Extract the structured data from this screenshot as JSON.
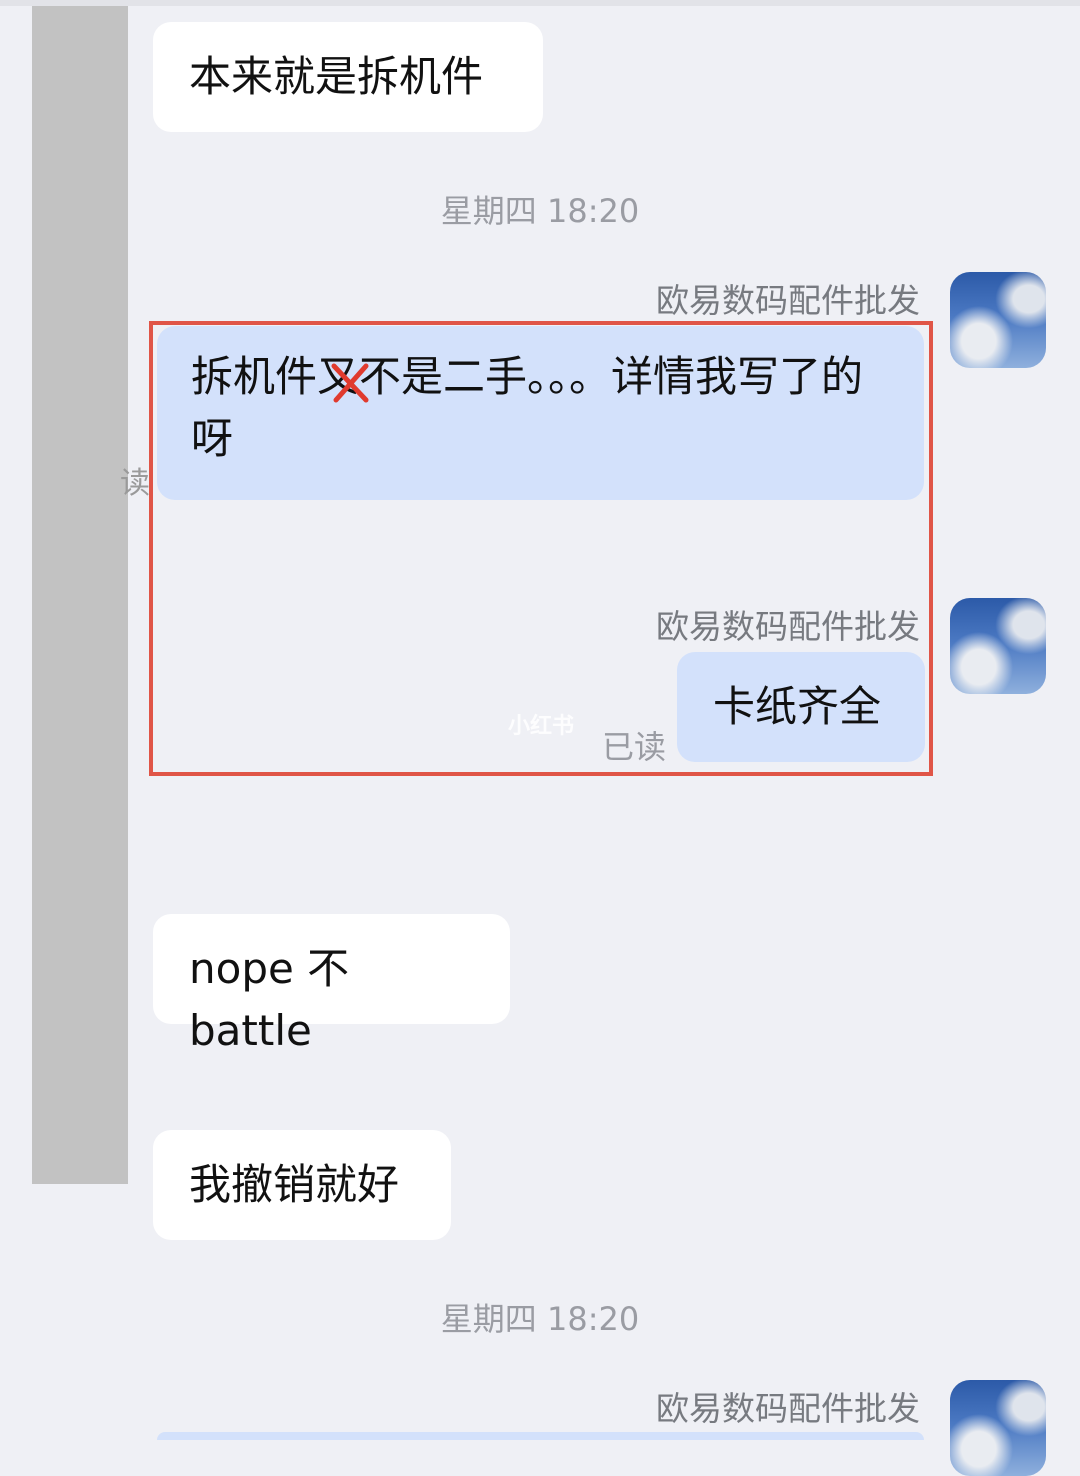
{
  "messages": {
    "m1": "本来就是拆机件",
    "m2": "拆机件又不是二手。。。详情我写了的呀",
    "m3": "卡纸齐全",
    "m4": "nope 不 battle",
    "m5": "我撤销就好"
  },
  "timestamps": {
    "t1": "星期四 18:20",
    "t2": "星期四 18:20"
  },
  "sender": {
    "name": "欧易数码配件批发"
  },
  "status": {
    "read": "已读",
    "partial_read": "读"
  },
  "watermark": {
    "text": "小红书"
  },
  "annotations": {
    "highlight_color": "#e05547",
    "strike_color": "#e03a2e"
  },
  "colors": {
    "incoming_bubble": "#ffffff",
    "outgoing_bubble": "#d3e1fb",
    "background": "#eff0f5"
  }
}
